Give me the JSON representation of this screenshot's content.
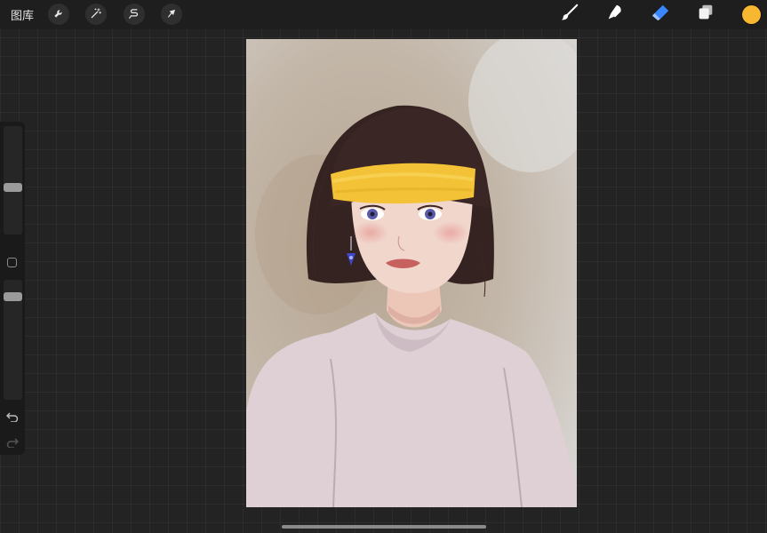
{
  "topbar": {
    "gallery_label": "图库",
    "left_tools": [
      {
        "icon": "wrench-icon",
        "name": "actions"
      },
      {
        "icon": "magic-wand-icon",
        "name": "adjustments"
      },
      {
        "icon": "selection-s-icon",
        "name": "selection"
      },
      {
        "icon": "arrow-cursor-icon",
        "name": "transform"
      }
    ],
    "right_tools": [
      {
        "icon": "brush-icon",
        "name": "brush",
        "active": false
      },
      {
        "icon": "smudge-icon",
        "name": "smudge",
        "active": false
      },
      {
        "icon": "eraser-icon",
        "name": "eraser",
        "active": true
      },
      {
        "icon": "layers-icon",
        "name": "layers",
        "active": false
      }
    ],
    "current_color": "#f7b731"
  },
  "sidebar": {
    "brush_size_level": 0.43,
    "opacity_level": 0.89,
    "controls": [
      "undo",
      "redo"
    ]
  },
  "colors": {
    "background": "#232323",
    "toolbar": "#1e1e1e",
    "active_tool": "#3a86ff",
    "color_swatch": "#f7b731"
  }
}
